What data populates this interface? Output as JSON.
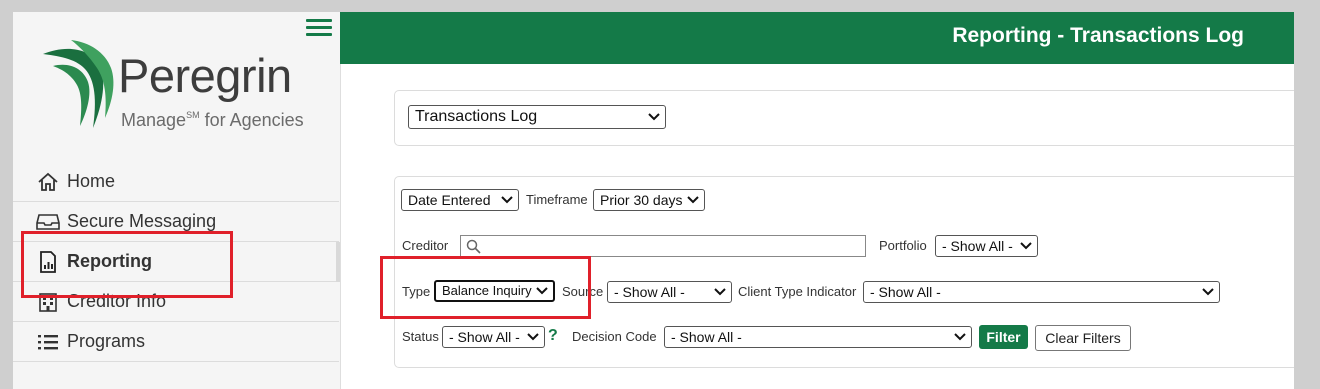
{
  "brand": {
    "name": "Peregrin",
    "tagline_pre": "Manage",
    "tagline_sup": "SM",
    "tagline_post": " for Agencies"
  },
  "header": {
    "title": "Reporting - Transactions Log"
  },
  "sidebar": {
    "items": [
      {
        "label": "Home",
        "icon": "home-icon"
      },
      {
        "label": "Secure Messaging",
        "icon": "inbox-icon"
      },
      {
        "label": "Reporting",
        "icon": "report-icon",
        "active": true
      },
      {
        "label": "Creditor Info",
        "icon": "building-icon"
      },
      {
        "label": "Programs",
        "icon": "list-icon"
      }
    ]
  },
  "report_select": {
    "value": "Transactions Log"
  },
  "filters": {
    "date_field": "Date Entered",
    "timeframe_label": "Timeframe",
    "timeframe_value": "Prior 30 days",
    "creditor_label": "Creditor",
    "creditor_value": "",
    "portfolio_label": "Portfolio",
    "portfolio_value": "- Show All -",
    "type_label": "Type",
    "type_value": "Balance Inquiry",
    "source_label": "Source",
    "source_value": "- Show All -",
    "client_type_label": "Client Type Indicator",
    "client_type_value": "- Show All -",
    "status_label": "Status",
    "status_value": "- Show All -",
    "help_glyph": "?",
    "decision_label": "Decision Code",
    "decision_value": "- Show All -",
    "filter_button": "Filter",
    "clear_button": "Clear Filters"
  },
  "colors": {
    "brand_green": "#147a48",
    "highlight_red": "#e0202a"
  }
}
